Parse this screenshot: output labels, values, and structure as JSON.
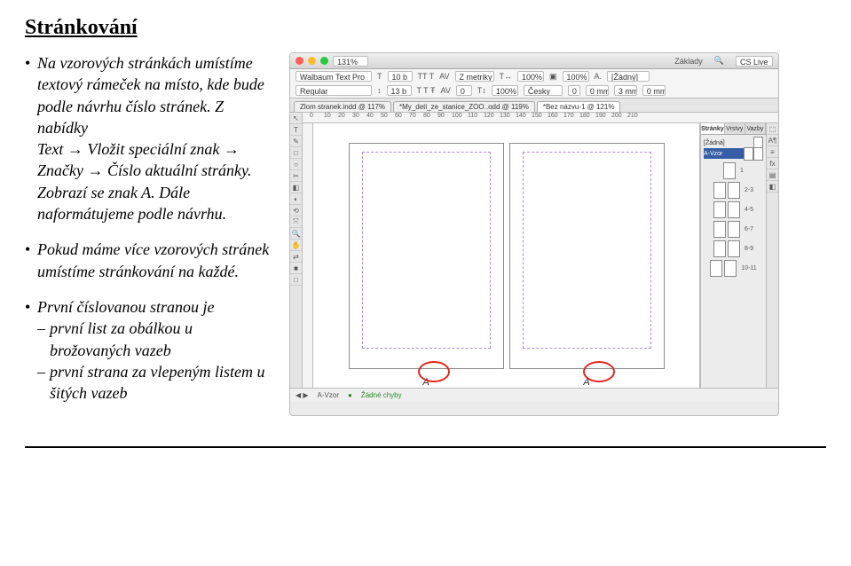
{
  "title": "Stránkování",
  "left": {
    "para1": "Na vzorových stránkách umístíme textový rámeček na místo, kde bude podle návrhu číslo stránek. Z nabídky",
    "para1b": "Text → Vložit speciální znak → Značky → Číslo aktuální stránky.",
    "para1c": "Zobrazí se znak A. Dále naformátujeme podle návrhu.",
    "para2": "Pokud máme více vzorových stránek umístíme stránkování na každé.",
    "para3": "První číslovanou stranou je",
    "sub1": "první list za obálkou u brožovaných vazeb",
    "sub2": "první strana za vlepeným listem u šitých vazeb"
  },
  "shot": {
    "zoom": "131%",
    "doc_zoom": "100%",
    "basics_label": "Základy",
    "cslive": "CS Live",
    "font_family": "Walbaum Text Pro",
    "font_style": "Regular",
    "font_size_label": "T",
    "font_size": "10 b",
    "leading": "13 b",
    "tracking_label": "AV",
    "tracking1": "0",
    "tracking2": "0",
    "metrics_label": "Z metriky",
    "hscale": "100%",
    "vscale": "100%",
    "lang_label": "A.",
    "lang": "Žádný",
    "parastyle": "[Žádný]",
    "lang2": "Česky",
    "para_a": "0",
    "para_b": "0 mm",
    "para_c": "3 mm",
    "para_d": "0 mm",
    "tabs": {
      "t1": "Zlom stranek.indd @ 117%",
      "t2": "*My_deti_ze_stanice_ZOO..odd @ 119%",
      "t3": "*Bez názvu-1 @ 121%"
    },
    "ruler_ticks": [
      "0",
      "10",
      "20",
      "30",
      "40",
      "50",
      "60",
      "70",
      "80",
      "90",
      "100",
      "110",
      "120",
      "130",
      "140",
      "150",
      "160",
      "170",
      "180",
      "190",
      "200",
      "210"
    ],
    "a_left": "A",
    "a_right": "A",
    "panel_tabs": {
      "pages": "Stránky",
      "layers": "Vrstvy",
      "links": "Vazby"
    },
    "masters": {
      "none": "[Žádná]",
      "avzor": "A-Vzor"
    },
    "page_labels": [
      "1",
      "2-3",
      "4-5",
      "6-7",
      "8-9",
      "10-11"
    ],
    "footer": {
      "master": "A-Vzor",
      "errors": "Žádné chyby"
    },
    "tools": [
      "↖",
      "T",
      "✎",
      "□",
      "○",
      "✂",
      "◧",
      "◐",
      "⟲",
      "⤧",
      "🔍",
      "✋",
      "⇄",
      "■",
      "□"
    ]
  }
}
